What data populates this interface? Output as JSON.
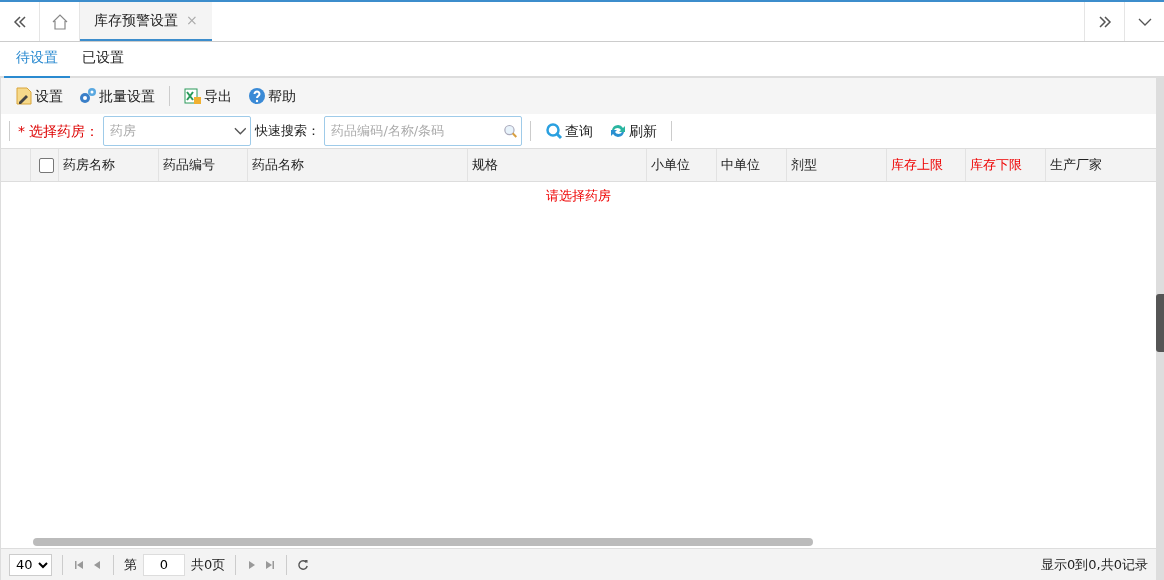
{
  "top_tabs": [
    {
      "label": "库存预警设置",
      "close": "×",
      "selected": true
    }
  ],
  "sub_tabs": [
    {
      "label": "待设置",
      "selected": true
    },
    {
      "label": "已设置",
      "selected": false
    }
  ],
  "toolbar_groups": [
    {
      "buttons": [
        {
          "label": "设置",
          "kind": "edit"
        },
        {
          "label": "批量设置",
          "kind": "gears"
        }
      ]
    },
    {
      "buttons": [
        {
          "label": "导出",
          "kind": "excel"
        },
        {
          "label": "帮助",
          "kind": "help"
        }
      ]
    }
  ],
  "filter": {
    "required_mark": "*",
    "pharmacy_label": "选择药房：",
    "pharmacy_placeholder": "药房",
    "search_label": "快速搜索：",
    "search_placeholder": "药品编码/名称/条码",
    "buttons": [
      {
        "label": "查询",
        "kind": "search"
      },
      {
        "label": "刷新",
        "kind": "refresh"
      }
    ]
  },
  "table": {
    "select_all_checked": false,
    "columns": [
      {
        "label": "药房名称",
        "emphasis": false
      },
      {
        "label": "药品编号",
        "emphasis": false
      },
      {
        "label": "药品名称",
        "emphasis": false
      },
      {
        "label": "规格",
        "emphasis": false
      },
      {
        "label": "小单位",
        "emphasis": false
      },
      {
        "label": "中单位",
        "emphasis": false
      },
      {
        "label": "剂型",
        "emphasis": false
      },
      {
        "label": "库存上限",
        "emphasis": true
      },
      {
        "label": "库存下限",
        "emphasis": true
      },
      {
        "label": "生产厂家",
        "emphasis": false
      }
    ],
    "empty_message": "请选择药房"
  },
  "pager": {
    "page_size": "40",
    "page_prefix": "第",
    "page": "0",
    "page_suffix": "共0页",
    "summary": "显示0到0,共0记录"
  }
}
